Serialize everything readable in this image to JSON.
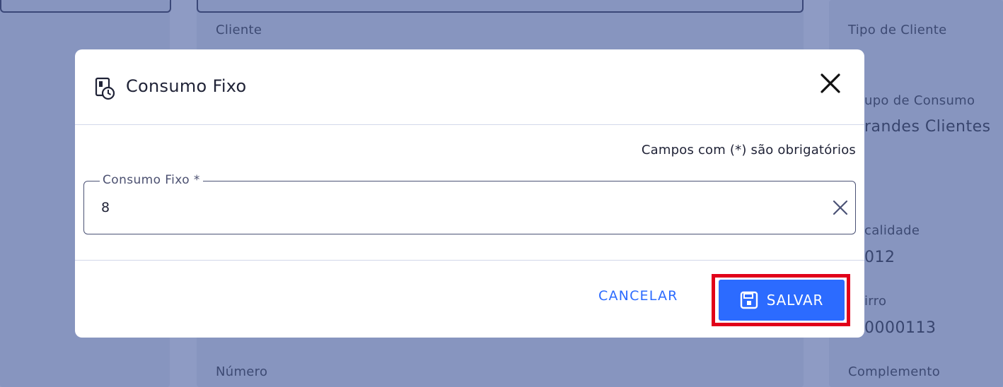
{
  "background": {
    "labels": {
      "cliente": "Cliente",
      "tipo_cliente": "Tipo de Cliente",
      "grupo_consumo": "upo de Consumo",
      "localidade": "calidade",
      "bairro": "irro",
      "numero": "Número",
      "complemento": "Complemento"
    },
    "values": {
      "grupo_consumo": "randes Clientes",
      "localidade": "012",
      "bairro": "0000113"
    }
  },
  "modal": {
    "title": "Consumo Fixo",
    "title_icon": "calendar-clock-icon",
    "close_icon": "close-icon",
    "required_note": "Campos com (*) são obrigatórios",
    "field": {
      "label": "Consumo Fixo *",
      "value": "8",
      "clear_icon": "clear-icon"
    },
    "actions": {
      "cancel_label": "CANCELAR",
      "save_label": "SALVAR",
      "save_icon": "save-icon"
    }
  },
  "colors": {
    "primary": "#2c6bff",
    "highlight": "#e1001a",
    "overlay": "#8e9bc4"
  }
}
